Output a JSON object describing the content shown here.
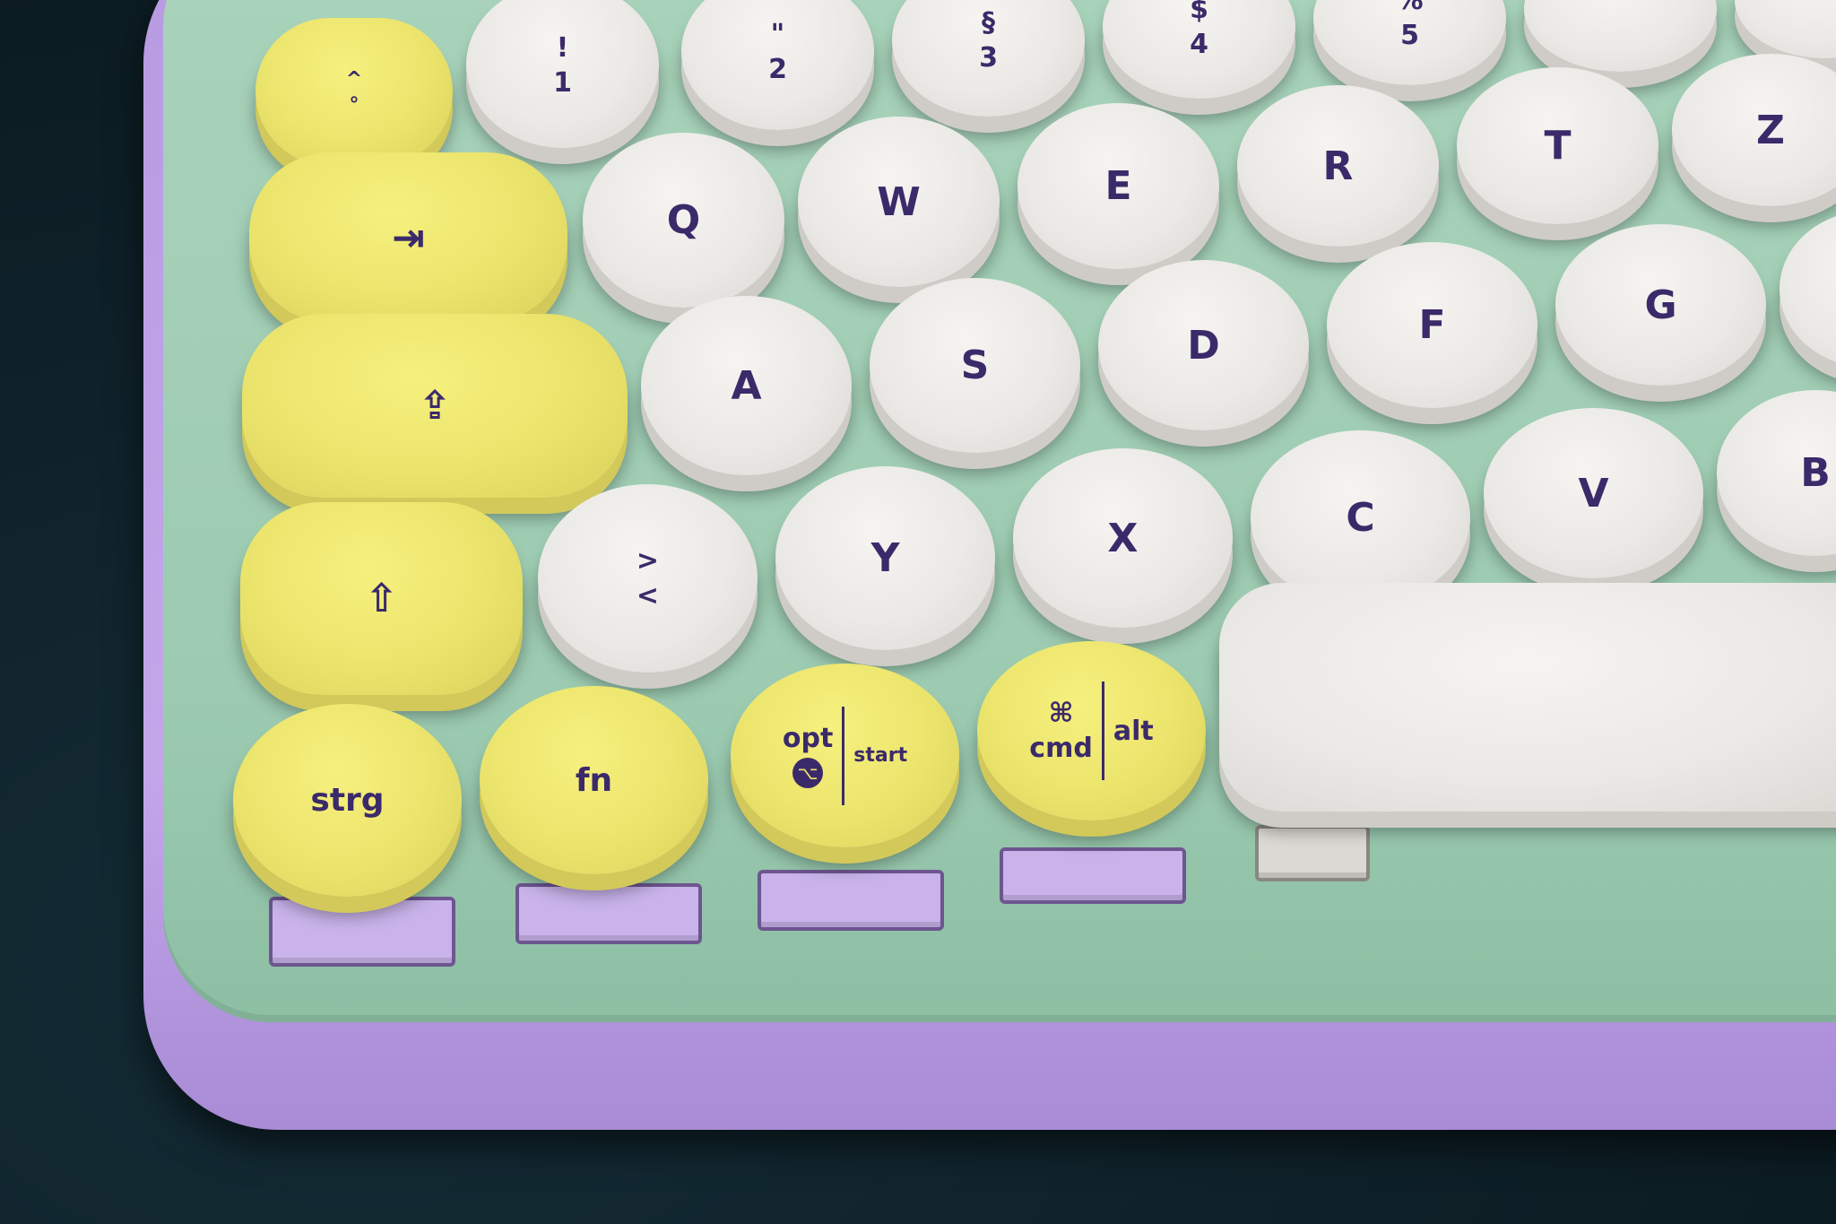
{
  "keys": {
    "num1_top": "!",
    "num1_bottom": "1",
    "num2_top": "\"",
    "num2_bottom": "2",
    "num3_top": "§",
    "num3_bottom": "3",
    "num4_top": "$",
    "num4_bottom": "4",
    "num5_top": "%",
    "num5_bottom": "5",
    "q": "Q",
    "w": "W",
    "e": "E",
    "r": "R",
    "t": "T",
    "z": "Z",
    "a": "A",
    "s": "S",
    "d": "D",
    "f": "F",
    "g": "G",
    "angle_top": ">",
    "angle_bottom": "<",
    "y": "Y",
    "x": "X",
    "c": "C",
    "v": "V",
    "b": "B",
    "strg": "strg",
    "fn": "fn",
    "opt": "opt",
    "opt_symbol": "⌥",
    "start": "start",
    "cmd_symbol": "⌘",
    "cmd": "cmd",
    "alt": "alt",
    "tab_symbol": "⇥",
    "shift_symbol": "⇧",
    "caps_symbol": "⇪",
    "caret_top": "^",
    "caret_bottom": "°"
  },
  "colors": {
    "shell": "#c3a6ea",
    "plate": "#9ccbb1",
    "key_white": "#ebe9e6",
    "key_yellow": "#ebe46c",
    "legend": "#3b2a6a",
    "background": "#10232b"
  }
}
